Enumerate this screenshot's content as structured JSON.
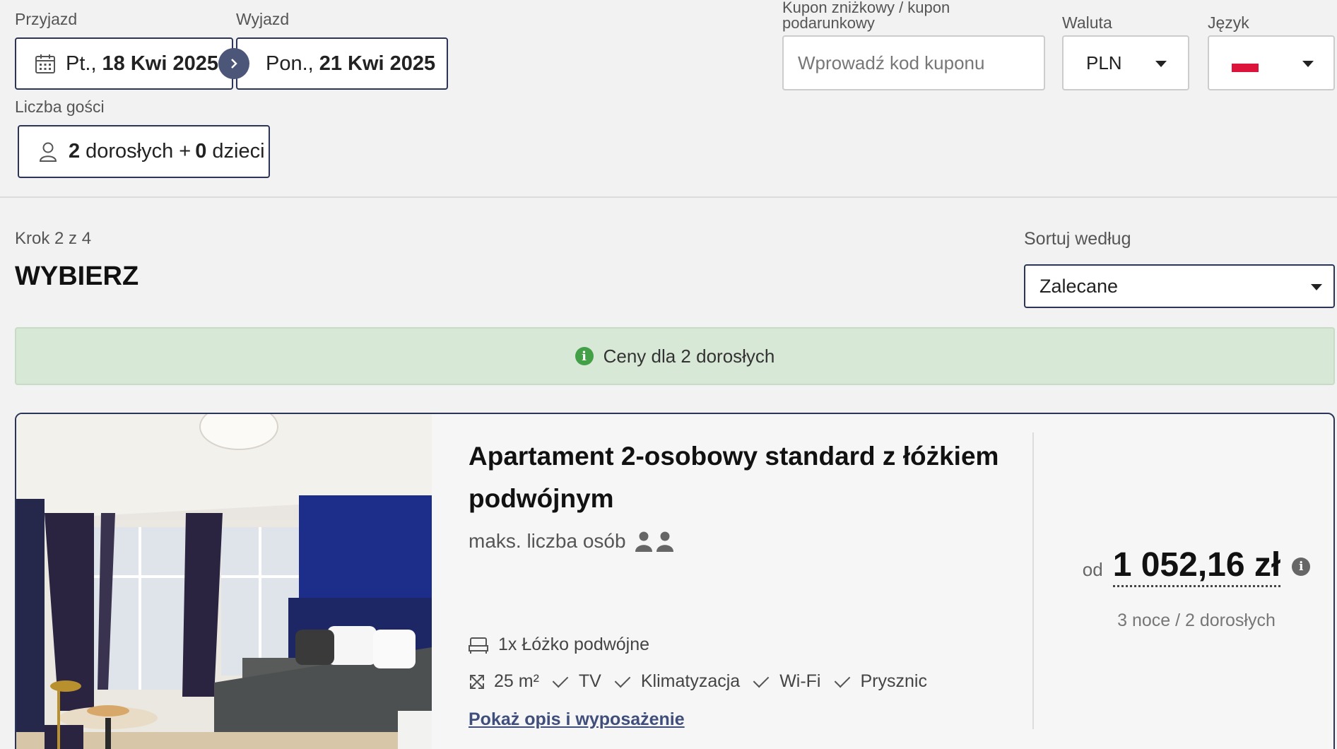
{
  "search": {
    "arrival_label": "Przyjazd",
    "arrival_day": "Pt.,",
    "arrival_date": "18 Kwi 2025",
    "departure_label": "Wyjazd",
    "departure_day": "Pon.,",
    "departure_date": "21 Kwi 2025",
    "guests_label": "Liczba gości",
    "adults_count": "2",
    "adults_text": "dorosłych +",
    "children_count": "0",
    "children_text": "dzieci",
    "coupon_label_line1": "Kupon zniżkowy / kupon",
    "coupon_label_line2": "podarunkowy",
    "coupon_placeholder": "Wprowadź kod kuponu",
    "currency_label": "Waluta",
    "currency_value": "PLN",
    "language_label": "Język"
  },
  "step": {
    "counter": "Krok 2 z 4",
    "title": "WYBIERZ"
  },
  "sort": {
    "label": "Sortuj według",
    "value": "Zalecane"
  },
  "notice": {
    "text": "Ceny dla 2 dorosłych"
  },
  "room": {
    "title": "Apartament 2-osobowy standard z łóżkiem podwójnym",
    "max_persons_label": "maks. liczba osób",
    "bed": "1x Łóżko podwójne",
    "area": "25 m²",
    "amenities": [
      "TV",
      "Klimatyzacja",
      "Wi-Fi",
      "Prysznic"
    ],
    "details_link": "Pokaż opis i wyposażenie",
    "price_prefix": "od",
    "price": "1 052,16 zł",
    "price_note": "3 noce / 2 dorosłych"
  },
  "colors": {
    "border_accent": "#2c3558",
    "notice_bg": "#d8e8d6",
    "info_green": "#43a047",
    "link": "#3f4e7a"
  }
}
